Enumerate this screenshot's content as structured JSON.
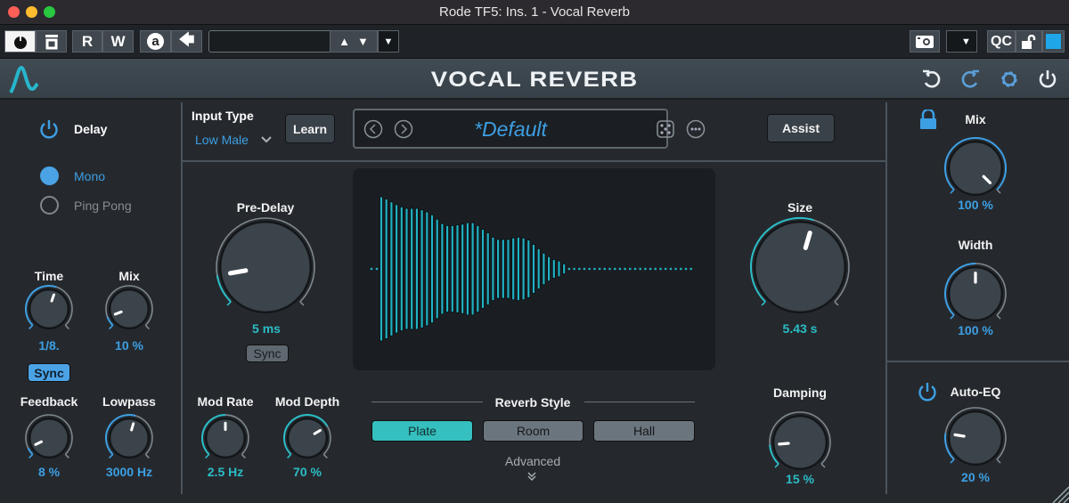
{
  "window": {
    "title": "Rode TF5: Ins. 1 - Vocal Reverb"
  },
  "toolbar": {
    "read_label": "R",
    "write_label": "W",
    "auto_label": "a",
    "preset_field": "",
    "qc_label": "QC",
    "accent": "#1ea6e8"
  },
  "header": {
    "title": "VOCAL REVERB"
  },
  "delay": {
    "label": "Delay",
    "mode_options": [
      "Mono",
      "Ping Pong"
    ],
    "selected_mode": "Mono",
    "time": {
      "label": "Time",
      "value": "1/8.",
      "fraction": 0.57
    },
    "mix": {
      "label": "Mix",
      "value": "10 %",
      "fraction": 0.09
    },
    "sync_label": "Sync",
    "feedback": {
      "label": "Feedback",
      "value": "8 %",
      "fraction": 0.07
    },
    "lowpass": {
      "label": "Lowpass",
      "value": "3000 Hz",
      "fraction": 0.56
    }
  },
  "input_type": {
    "label": "Input Type",
    "value": "Low Male",
    "learn_label": "Learn"
  },
  "preset": {
    "name": "*Default",
    "assist_label": "Assist"
  },
  "reverb": {
    "pre_delay": {
      "label": "Pre-Delay",
      "value": "5 ms",
      "fraction": 0.13
    },
    "sync_label": "Sync",
    "mod_rate": {
      "label": "Mod Rate",
      "value": "2.5 Hz",
      "fraction": 0.5
    },
    "mod_depth": {
      "label": "Mod Depth",
      "value": "70 %",
      "fraction": 0.72
    },
    "size": {
      "label": "Size",
      "value": "5.43 s",
      "fraction": 0.56
    },
    "damping": {
      "label": "Damping",
      "value": "15 %",
      "fraction": 0.15
    },
    "style": {
      "label": "Reverb Style",
      "options": [
        "Plate",
        "Room",
        "Hall"
      ],
      "selected": "Plate"
    },
    "advanced_label": "Advanced"
  },
  "waveform": {
    "amplitudes": [
      1.0,
      0.97,
      0.93,
      0.89,
      0.86,
      0.84,
      0.84,
      0.84,
      0.82,
      0.79,
      0.75,
      0.69,
      0.63,
      0.6,
      0.6,
      0.61,
      0.62,
      0.64,
      0.64,
      0.6,
      0.55,
      0.5,
      0.44,
      0.41,
      0.41,
      0.41,
      0.43,
      0.44,
      0.43,
      0.4,
      0.34,
      0.28,
      0.22,
      0.17,
      0.13,
      0.11,
      0.07
    ]
  },
  "output": {
    "mix": {
      "label": "Mix",
      "value": "100 %",
      "fraction": 1.0
    },
    "width": {
      "label": "Width",
      "value": "100 %",
      "fraction": 0.5
    },
    "auto_eq": {
      "label": "Auto-EQ",
      "value": "20 %",
      "fraction": 0.2
    }
  },
  "colors": {
    "blue": "#3d9fe3",
    "teal": "#2bbdc6",
    "plate_active": "#35bfbe"
  }
}
